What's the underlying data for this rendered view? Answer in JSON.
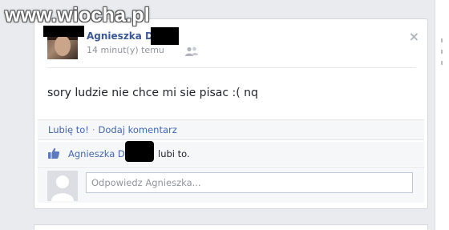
{
  "watermark": "www.wiocha.pl",
  "post": {
    "author": "Agnieszka D",
    "timestamp": "14 minut(y) temu",
    "audience_icon": "friends-icon",
    "close_icon": "close-icon",
    "close_glyph": "×",
    "body": "sory ludzie nie chce mi sie pisac :( nq"
  },
  "actions": {
    "like_label": "Lubię to!",
    "separator": "·",
    "comment_label": "Dodaj komentarz"
  },
  "likes": {
    "icon": "thumbs-up-icon",
    "name": "Agnieszka D",
    "suffix": "lubi to."
  },
  "reply": {
    "placeholder": "Odpowiedz Agnieszka...",
    "value": ""
  },
  "colors": {
    "link": "#3b5998",
    "action_link": "#4267b2",
    "muted": "#90949c",
    "censor": "#000000"
  }
}
